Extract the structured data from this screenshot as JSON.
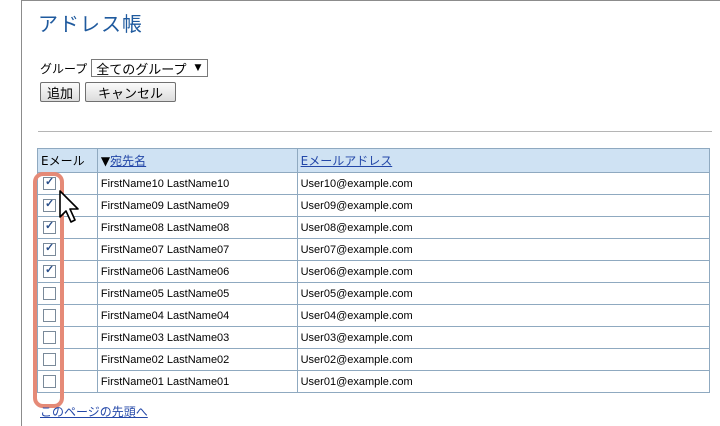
{
  "page": {
    "title": "アドレス帳"
  },
  "group": {
    "label": "グループ",
    "selected": "全てのグループ"
  },
  "buttons": {
    "add": "追加",
    "cancel": "キャンセル"
  },
  "table": {
    "headers": {
      "email": "Eメール",
      "sort_indicator": "▼",
      "name": "宛先名",
      "address": "Eメールアドレス"
    },
    "rows": [
      {
        "checked": true,
        "name": "FirstName10 LastName10",
        "email": "User10@example.com"
      },
      {
        "checked": true,
        "name": "FirstName09 LastName09",
        "email": "User09@example.com"
      },
      {
        "checked": true,
        "name": "FirstName08 LastName08",
        "email": "User08@example.com"
      },
      {
        "checked": true,
        "name": "FirstName07 LastName07",
        "email": "User07@example.com"
      },
      {
        "checked": true,
        "name": "FirstName06 LastName06",
        "email": "User06@example.com"
      },
      {
        "checked": false,
        "name": "FirstName05 LastName05",
        "email": "User05@example.com"
      },
      {
        "checked": false,
        "name": "FirstName04 LastName04",
        "email": "User04@example.com"
      },
      {
        "checked": false,
        "name": "FirstName03 LastName03",
        "email": "User03@example.com"
      },
      {
        "checked": false,
        "name": "FirstName02 LastName02",
        "email": "User02@example.com"
      },
      {
        "checked": false,
        "name": "FirstName01 LastName01",
        "email": "User01@example.com"
      }
    ]
  },
  "footer": {
    "back_to_top": "このページの先頭へ"
  },
  "icons": {
    "dropdown": "chevron-down-icon",
    "pointer": "mouse-pointer-icon"
  },
  "colors": {
    "title": "#1f5a9e",
    "header_bg": "#cfe2f3",
    "link": "#2347a8",
    "highlight": "#e58a77"
  }
}
